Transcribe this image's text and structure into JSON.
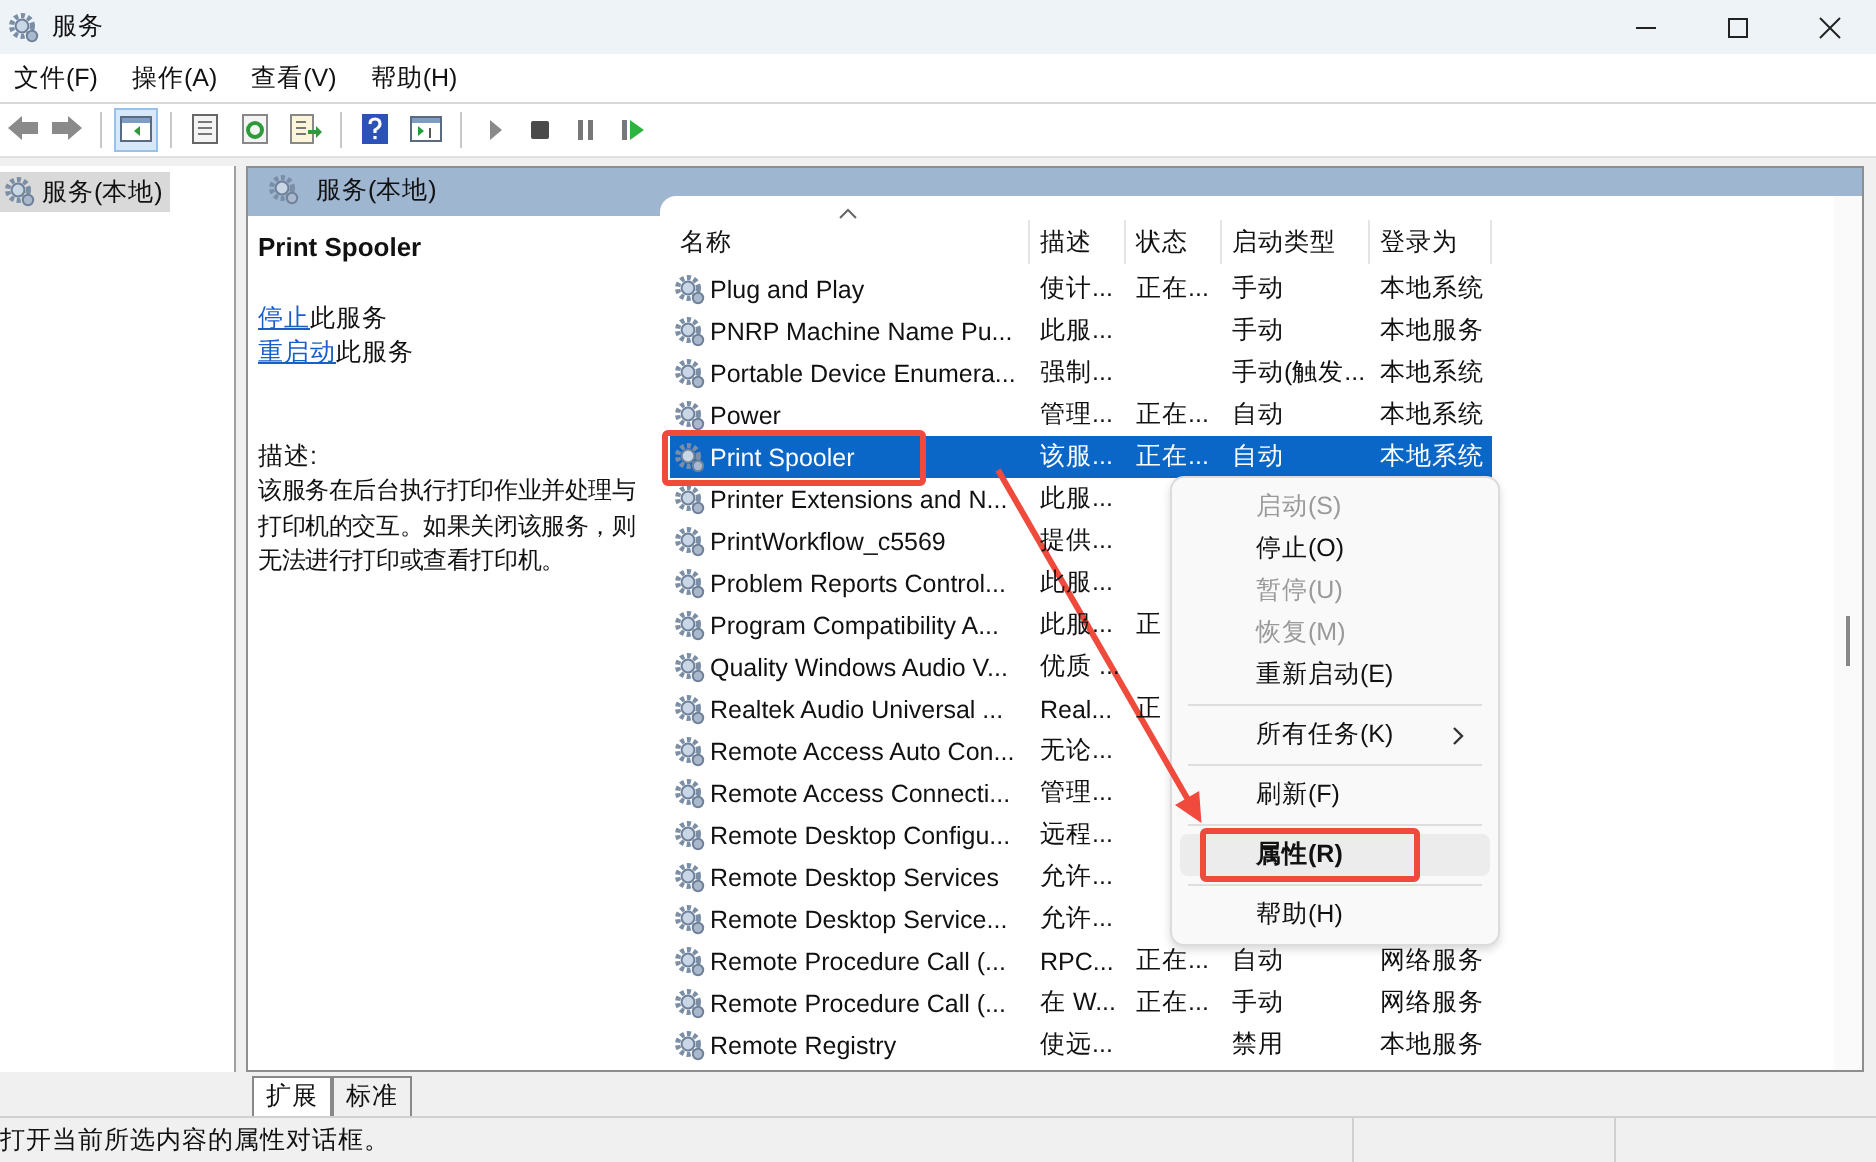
{
  "window": {
    "title": "服务"
  },
  "menu_bar": [
    "文件(F)",
    "操作(A)",
    "查看(V)",
    "帮助(H)"
  ],
  "tree": [
    {
      "label": "服务(本地)",
      "selected": true
    }
  ],
  "pane": {
    "title": "服务(本地)"
  },
  "detail": {
    "title": "Print Spooler",
    "actions": [
      {
        "link": "停止",
        "text": "此服务"
      },
      {
        "link": "重启动",
        "text": "此服务"
      }
    ],
    "description_label": "描述:",
    "description": "该服务在后台执行打印作业并处理与打印机的交互。如果关闭该服务，则无法进行打印或查看打印机。"
  },
  "table": {
    "columns": [
      "名称",
      "描述",
      "状态",
      "启动类型",
      "登录为"
    ],
    "rows": [
      {
        "name": "Plug and Play",
        "description": "使计...",
        "status": "正在...",
        "startup": "手动",
        "logon": "本地系统",
        "selected": false
      },
      {
        "name": "PNRP Machine Name Pu...",
        "description": "此服...",
        "startup": "手动",
        "logon": "本地服务",
        "selected": false
      },
      {
        "name": "Portable Device Enumera...",
        "description": "强制...",
        "startup": "手动(触发...",
        "logon": "本地系统",
        "selected": false
      },
      {
        "name": "Power",
        "description": "管理...",
        "status": "正在...",
        "startup": "自动",
        "logon": "本地系统",
        "selected": false
      },
      {
        "name": "Print Spooler",
        "description": "该服...",
        "status": "正在...",
        "startup": "自动",
        "logon": "本地系统",
        "selected": true,
        "highlighted": true
      },
      {
        "name": "Printer Extensions and N...",
        "description": "此服...",
        "selected": false
      },
      {
        "name": "PrintWorkflow_c5569",
        "description": "提供...",
        "selected": false
      },
      {
        "name": "Problem Reports Control...",
        "description": "此服...",
        "selected": false
      },
      {
        "name": "Program Compatibility A...",
        "description": "此服...",
        "status": "正",
        "selected": false
      },
      {
        "name": "Quality Windows Audio V...",
        "description": "优质 ...",
        "selected": false
      },
      {
        "name": "Realtek Audio Universal ...",
        "description": "Real...",
        "status": "正",
        "selected": false
      },
      {
        "name": "Remote Access Auto Con...",
        "description": "无论...",
        "selected": false
      },
      {
        "name": "Remote Access Connecti...",
        "description": "管理...",
        "selected": false
      },
      {
        "name": "Remote Desktop Configu...",
        "description": "远程...",
        "selected": false
      },
      {
        "name": "Remote Desktop Services",
        "description": "允许...",
        "selected": false
      },
      {
        "name": "Remote Desktop Service...",
        "description": "允许...",
        "selected": false
      },
      {
        "name": "Remote Procedure Call (...",
        "description": "RPC...",
        "status": "正在...",
        "startup": "自动",
        "logon": "网络服务",
        "selected": false
      },
      {
        "name": "Remote Procedure Call (...",
        "description": "在 W...",
        "status": "正在...",
        "startup": "手动",
        "logon": "网络服务",
        "selected": false
      },
      {
        "name": "Remote Registry",
        "description": "使远...",
        "startup": "禁用",
        "logon": "本地服务",
        "selected": false
      }
    ]
  },
  "context_menu": [
    {
      "kind": "item",
      "label": "启动(S)",
      "disabled": true
    },
    {
      "kind": "item",
      "label": "停止(O)",
      "disabled": false
    },
    {
      "kind": "item",
      "label": "暂停(U)",
      "disabled": true
    },
    {
      "kind": "item",
      "label": "恢复(M)",
      "disabled": true
    },
    {
      "kind": "item",
      "label": "重新启动(E)",
      "disabled": false
    },
    {
      "kind": "separator"
    },
    {
      "kind": "item",
      "label": "所有任务(K)",
      "disabled": false,
      "submenu": true
    },
    {
      "kind": "separator"
    },
    {
      "kind": "item",
      "label": "刷新(F)",
      "disabled": false
    },
    {
      "kind": "separator"
    },
    {
      "kind": "item",
      "label": "属性(R)",
      "disabled": false,
      "bold": true,
      "hovered": true,
      "highlighted": true
    },
    {
      "kind": "separator"
    },
    {
      "kind": "item",
      "label": "帮助(H)",
      "disabled": false
    }
  ],
  "view_tabs": [
    {
      "label": "扩展",
      "selected": true
    },
    {
      "label": "标准",
      "selected": false
    }
  ],
  "status_bar": {
    "text": "打开当前所选内容的属性对话框。"
  }
}
